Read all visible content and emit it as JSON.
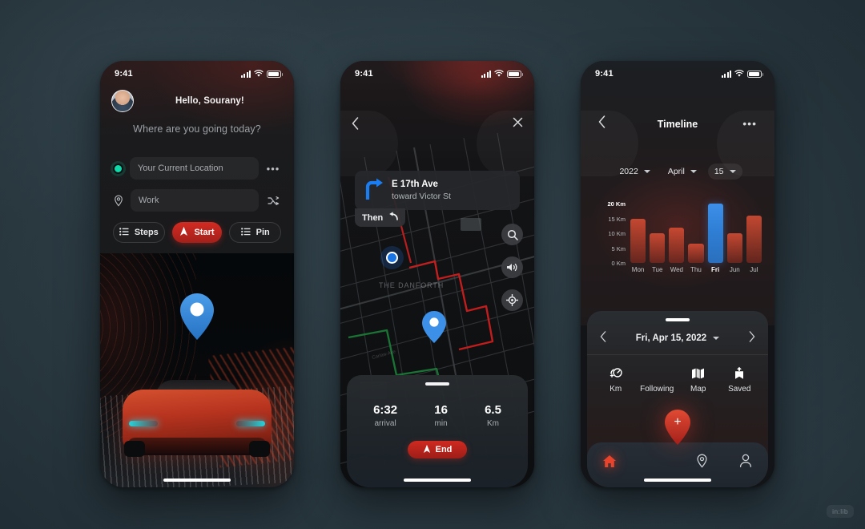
{
  "background": {
    "base_color": "#2c3b43"
  },
  "watermark": {
    "label": "in:lib"
  },
  "status_bar": {
    "time": "9:41"
  },
  "screen1": {
    "greeting": "Hello, Sourany!",
    "question": "Where are you going today?",
    "origin": {
      "value": "Your Current Location",
      "icon": "current-location-dot",
      "action_icon": "more-options-icon"
    },
    "destination": {
      "value": "Work",
      "icon": "map-pin-icon",
      "action_icon": "shuffle-icon"
    },
    "actions": [
      {
        "label": "Steps",
        "icon": "list-icon",
        "style": "outline"
      },
      {
        "label": "Start",
        "icon": "navigation-arrow-icon",
        "style": "primary",
        "color": "#c62a20"
      },
      {
        "label": "Pin",
        "icon": "list-icon",
        "style": "outline"
      }
    ]
  },
  "screen2": {
    "back_icon": "chevron-left-icon",
    "close_icon": "close-icon",
    "direction": {
      "street": "E 17th Ave",
      "toward": "toward Victor St",
      "maneuver_icon": "turn-right-icon"
    },
    "then_badge": {
      "label": "Then",
      "icon": "turn-left-icon"
    },
    "side_buttons": [
      {
        "name": "search-icon"
      },
      {
        "name": "volume-icon"
      },
      {
        "name": "recenter-icon"
      }
    ],
    "map": {
      "area_label": "THE DANFORTH",
      "route_color": "#e02020",
      "alt_route_color": "#1e8a3c"
    },
    "eta": [
      {
        "value": "6:32",
        "label": "arrival"
      },
      {
        "value": "16",
        "label": "min"
      },
      {
        "value": "6.5",
        "label": "Km"
      }
    ],
    "end_button": {
      "label": "End",
      "icon": "navigation-arrow-icon",
      "color": "#c62a20"
    }
  },
  "screen3": {
    "title": "Timeline",
    "back_icon": "chevron-left-icon",
    "more_icon": "more-options-icon",
    "date_selector": [
      {
        "value": "2022",
        "selected": false
      },
      {
        "value": "April",
        "selected": false
      },
      {
        "value": "15",
        "selected": true
      }
    ],
    "date_nav": {
      "prev_icon": "chevron-left-icon",
      "next_icon": "chevron-right-icon",
      "label": "Fri, Apr 15, 2022",
      "caret_icon": "chevron-down-icon"
    },
    "quick_actions": [
      {
        "label": "Km",
        "icon": "odometer-icon"
      },
      {
        "label": "Following",
        "icon": "following-icon"
      },
      {
        "label": "Map",
        "icon": "map-icon"
      },
      {
        "label": "Saved",
        "icon": "save-upload-icon"
      }
    ],
    "fab": {
      "icon": "plus-icon",
      "color": "#d73728"
    },
    "tabs": [
      {
        "name": "home-icon",
        "active": true
      },
      {
        "name": "location-pin-icon",
        "active": false
      },
      {
        "name": "profile-icon",
        "active": false
      }
    ],
    "chart_data": {
      "type": "bar",
      "title": "",
      "categories": [
        "Mon",
        "Tue",
        "Wed",
        "Thu",
        "Fri",
        "Jun",
        "Jul"
      ],
      "values": [
        15,
        10,
        12,
        6.5,
        20,
        10,
        16
      ],
      "highlight_index": 4,
      "xlabel": "",
      "ylabel": "Km",
      "ylim": [
        0,
        20
      ],
      "yticks": [
        0,
        5,
        10,
        15,
        20
      ],
      "ytick_labels": [
        "0 Km",
        "5 Km",
        "10 Km",
        "15 Km",
        "20 Km"
      ],
      "grid": false,
      "legend": "none",
      "bar_color": "#c0452c",
      "highlight_color": "#2f7fd6"
    }
  }
}
